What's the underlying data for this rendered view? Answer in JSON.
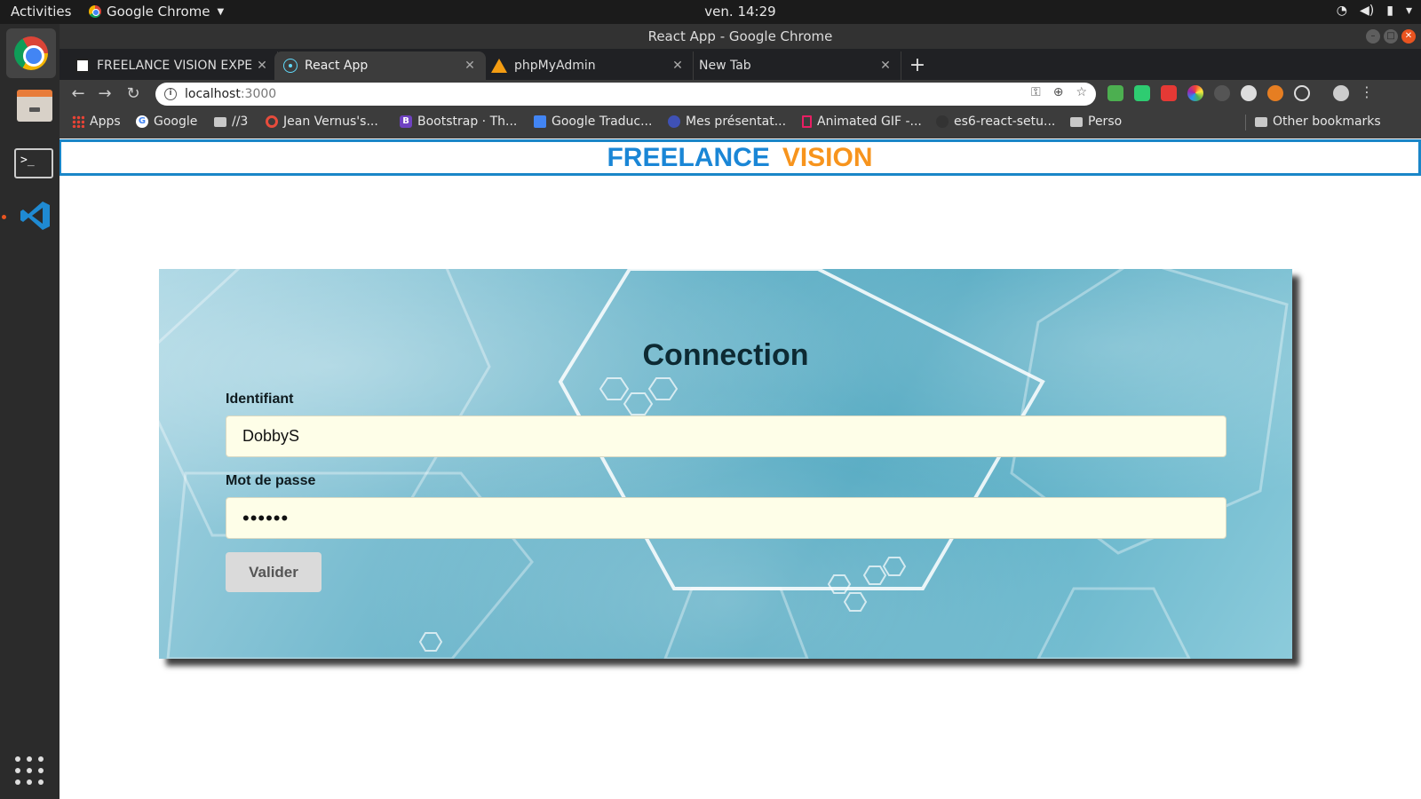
{
  "system": {
    "activities_label": "Activities",
    "app_menu_label": "Google Chrome",
    "clock": "ven. 14:29"
  },
  "window": {
    "title": "React App - Google Chrome"
  },
  "tabs": [
    {
      "label": "FREELANCE VISION EXPE",
      "favicon": "fv-icon"
    },
    {
      "label": "React App",
      "favicon": "react-icon",
      "active": true
    },
    {
      "label": "phpMyAdmin",
      "favicon": "phpmyadmin-icon"
    },
    {
      "label": "New Tab",
      "favicon": ""
    }
  ],
  "address_bar": {
    "host": "localhost",
    "port": ":3000"
  },
  "bookmarks": [
    {
      "label": "Apps",
      "icon": "apps-icon"
    },
    {
      "label": "Google",
      "icon": "google-icon"
    },
    {
      "label": "//3",
      "icon": "folder-icon"
    },
    {
      "label": "Jean Vernus's...",
      "icon": "site-icon"
    },
    {
      "label": "Bootstrap · Th...",
      "icon": "bootstrap-icon"
    },
    {
      "label": "Google Traduc...",
      "icon": "translate-icon"
    },
    {
      "label": "Mes présentat...",
      "icon": "site-icon"
    },
    {
      "label": "Animated GIF -...",
      "icon": "doc-icon"
    },
    {
      "label": "es6-react-setu...",
      "icon": "github-icon"
    },
    {
      "label": "Perso",
      "icon": "folder-icon"
    },
    {
      "label": "Other bookmarks",
      "icon": "folder-icon"
    }
  ],
  "brand": {
    "part1": "FREELANCE",
    "part2": "VISION",
    "color1": "#1a86d6",
    "color2": "#f7941d"
  },
  "login": {
    "title": "Connection",
    "username_label": "Identifiant",
    "username_value": "DobbyS",
    "password_label": "Mot de passe",
    "password_value": "••••••",
    "submit_label": "Valider"
  }
}
